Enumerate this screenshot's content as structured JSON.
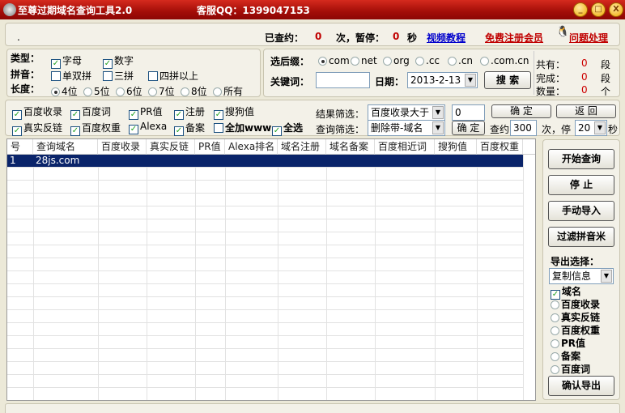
{
  "title": "至尊过期域名查询工具2.0",
  "support": "客服QQ：1399047153",
  "window_controls": {
    "minimize": "_",
    "maximize": "□",
    "close": "X"
  },
  "status": {
    "dot": ".",
    "queried_label": "已查约：",
    "queried": "0",
    "times_pause": "次，暂停：",
    "pause": "0",
    "sec": "秒",
    "video": "视频教程",
    "register": "免费注册会员",
    "help": "问题处理"
  },
  "filters": {
    "type_label": "类型：",
    "type_opts": [
      {
        "label": "字母",
        "checked": true
      },
      {
        "label": "数字",
        "checked": true
      }
    ],
    "pinyin_label": "拼音：",
    "pinyin_opts": [
      {
        "label": "单双拼",
        "checked": false
      },
      {
        "label": "三拼",
        "checked": false
      },
      {
        "label": "四拼以上",
        "checked": false
      }
    ],
    "length_label": "长度：",
    "length_opts": [
      {
        "label": "4位",
        "selected": true
      },
      {
        "label": "5位"
      },
      {
        "label": "6位"
      },
      {
        "label": "7位"
      },
      {
        "label": "8位"
      },
      {
        "label": "所有"
      }
    ]
  },
  "search": {
    "suffix_label": "选后缀：",
    "suffixes": [
      {
        "label": "com",
        "selected": true
      },
      {
        "label": "net"
      },
      {
        "label": "org"
      },
      {
        "label": ".cc"
      },
      {
        "label": ".cn"
      },
      {
        "label": ".com.cn"
      }
    ],
    "keyword_label": "关键词：",
    "keyword": "",
    "date_label": "日期：",
    "date": "2013-2-13",
    "search_btn": "搜 索"
  },
  "stats": {
    "total_label": "共有：",
    "total": "0",
    "total_unit": "段",
    "done_label": "完成：",
    "done": "0",
    "done_unit": "段",
    "count_label": "数量：",
    "count": "0",
    "count_unit": "个"
  },
  "options": [
    {
      "label": "百度收录",
      "checked": true
    },
    {
      "label": "百度词",
      "checked": true
    },
    {
      "label": "PR值",
      "checked": true
    },
    {
      "label": "注册",
      "checked": true
    },
    {
      "label": "搜狗值",
      "checked": true
    },
    {
      "label": "真实反链",
      "checked": true
    },
    {
      "label": "百度权重",
      "checked": true
    },
    {
      "label": "Alexa",
      "checked": true
    },
    {
      "label": "备案",
      "checked": true
    },
    {
      "label": "全加www",
      "checked": false
    },
    {
      "label": "全选",
      "checked": true
    }
  ],
  "result_filter": {
    "label": "结果筛选：",
    "value": "百度收录大于",
    "input": "0",
    "ok": "确 定",
    "back": "返 回"
  },
  "query_filter": {
    "label": "查询筛选：",
    "value": "删除带-域名",
    "ok": "确 定",
    "per_label": "查约",
    "per": "300",
    "stop_label": "次，停",
    "stop": "20",
    "sec": "秒"
  },
  "table": {
    "columns": [
      "号",
      "查询域名",
      "百度收录",
      "真实反链",
      "PR值",
      "Alexa排名",
      "域名注册",
      "域名备案",
      "百度相近词",
      "搜狗值",
      "百度权重"
    ],
    "rows": [
      [
        "1",
        "28js.com",
        "",
        "",
        "",
        "",
        "",
        "",
        "",
        "",
        ""
      ]
    ]
  },
  "actions": {
    "start": "开始查询",
    "stop": "停 止",
    "import": "手动导入",
    "filter_pinyin": "过滤拼音米"
  },
  "export": {
    "label": "导出选择：",
    "mode": "复制信息",
    "fields": [
      {
        "label": "域名",
        "checked": true
      },
      {
        "label": "百度收录"
      },
      {
        "label": "真实反链"
      },
      {
        "label": "百度权重"
      },
      {
        "label": "PR值"
      },
      {
        "label": "备案"
      },
      {
        "label": "百度词"
      }
    ],
    "confirm": "确认导出"
  },
  "colors": {
    "title_bar": "#b8140e",
    "accent_red": "#c00000",
    "selection": "#0a246a",
    "link_blue": "#0000cc"
  }
}
